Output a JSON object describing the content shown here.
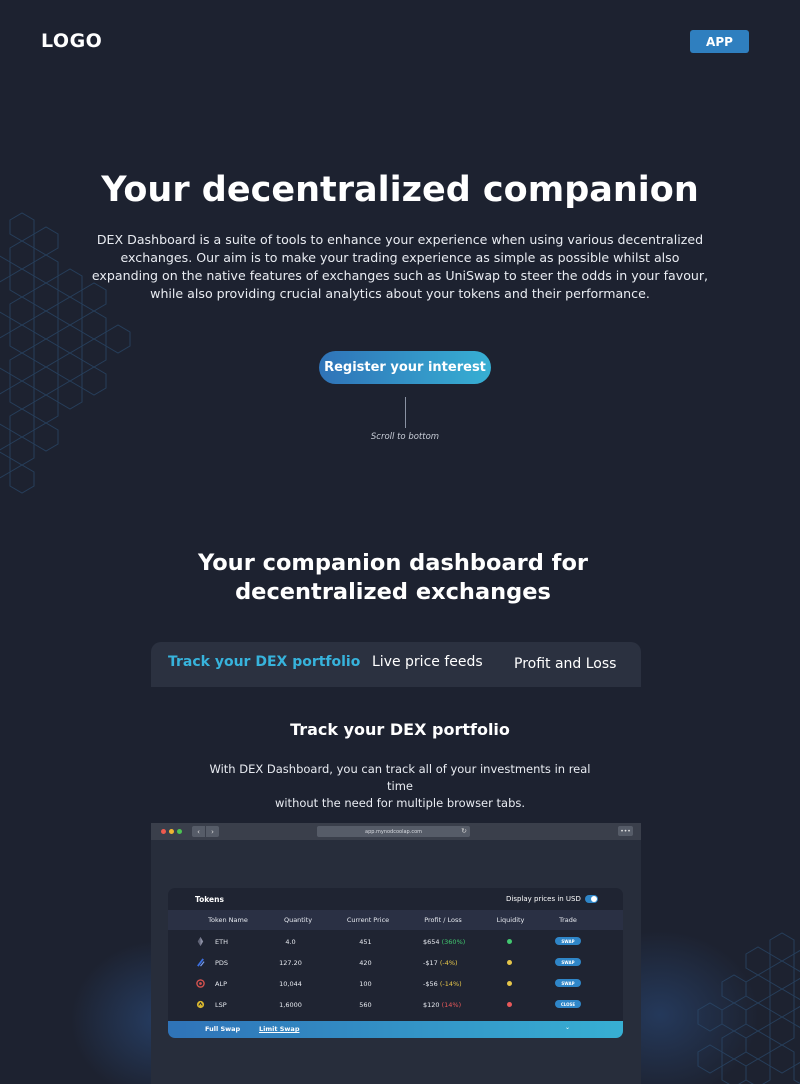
{
  "header": {
    "logo": "LOGO",
    "app_button": "APP"
  },
  "hero": {
    "title": "Your decentralized companion",
    "description": "DEX Dashboard is a suite of tools to enhance your experience when using various decentralized exchanges. Our aim is to make your trading experience as simple as possible whilst also expanding on the native features of exchanges such as UniSwap to steer the odds in your favour, while also providing crucial analytics about your tokens and their performance.",
    "cta": "Register your interest",
    "scroll_hint": "Scroll to bottom"
  },
  "features": {
    "title_line1": "Your companion dashboard for",
    "title_line2": "decentralized exchanges",
    "tabs": [
      {
        "label": "Track your DEX portfolio",
        "active": true
      },
      {
        "label": "Live price feeds",
        "active": false
      },
      {
        "label": "Profit and Loss",
        "active": false
      }
    ],
    "active_title": "Track your DEX portfolio",
    "active_description_line1": "With DEX Dashboard, you can track all of your investments in real time",
    "active_description_line2": "without the need for multiple browser tabs."
  },
  "browser": {
    "url": "app.mynodcoolap.com",
    "nav_back": "‹",
    "nav_forward": "›",
    "reload": "↻",
    "more": "•••"
  },
  "tokens_panel": {
    "title": "Tokens",
    "toggle_label": "Display prices in USD",
    "toggle_on": true,
    "columns": [
      "Token Name",
      "Quantity",
      "Current Price",
      "Profit / Loss",
      "Liquidity",
      "Trade"
    ],
    "rows": [
      {
        "icon": "eth-icon",
        "name": "ETH",
        "quantity": "4.0",
        "price": "451",
        "pl_value": "$654",
        "pl_pct": "(360%)",
        "pl_color": "#42c770",
        "liquidity_color": "#42c770",
        "trade": "SWAP"
      },
      {
        "icon": "pds-icon",
        "name": "PDS",
        "quantity": "127.20",
        "price": "420",
        "pl_value": "-$17",
        "pl_pct": "(-4%)",
        "pl_color": "#e5c54a",
        "liquidity_color": "#e5c54a",
        "trade": "SWAP"
      },
      {
        "icon": "alp-icon",
        "name": "ALP",
        "quantity": "10,044",
        "price": "100",
        "pl_value": "-$56",
        "pl_pct": "(-14%)",
        "pl_color": "#e5c54a",
        "liquidity_color": "#e5c54a",
        "trade": "SWAP"
      },
      {
        "icon": "lsp-icon",
        "name": "LSP",
        "quantity": "1,6000",
        "price": "560",
        "pl_value": "$120",
        "pl_pct": "(14%)",
        "pl_color": "#e8585a",
        "liquidity_color": "#e8585a",
        "trade": "CLOSE"
      }
    ],
    "swap_tabs": {
      "full": "Full Swap",
      "limit": "Limit Swap",
      "chevron": "⌄"
    }
  },
  "colors": {
    "background": "#1d2230",
    "accent": "#37b3dc",
    "button_blue": "#2f7fbf"
  }
}
